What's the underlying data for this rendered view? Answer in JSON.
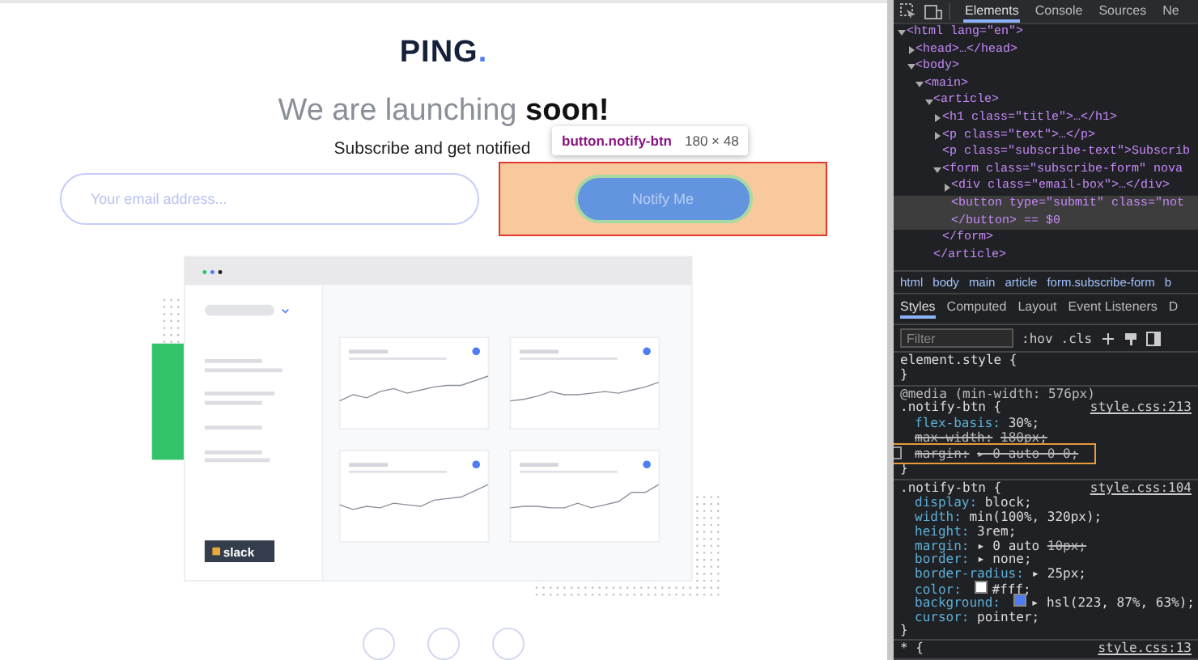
{
  "page": {
    "logo": {
      "text": "PING",
      "dot": "."
    },
    "heading": "We are launching **soon!**",
    "subtitle": "Subscribe and get notified",
    "email_field": {
      "placeholder": "Your email address..."
    },
    "notify_button": {
      "label": "Notify Me"
    },
    "inspect_tooltip": {
      "selector": "button.notify-btn",
      "size": "180 × 48"
    },
    "dashboard": {
      "slack_badge": "slack"
    }
  },
  "devtools": {
    "tabs": [
      {
        "label": "Elements",
        "selected": true
      },
      {
        "label": "Console",
        "selected": false
      },
      {
        "label": "Sources",
        "selected": false
      },
      {
        "label": "Ne",
        "selected": false
      }
    ],
    "dom_tree": [
      {
        "text": "<html lang=\"en\">",
        "expanded": true,
        "selected": false,
        "children": [
          {
            "text": "<head>…</head>",
            "expanded": false,
            "selected": false
          },
          {
            "text": "<body>",
            "expanded": true,
            "selected": false,
            "children": [
              {
                "text": "<main>",
                "expanded": true,
                "selected": false,
                "children": [
                  {
                    "text": "<article>",
                    "expanded": true,
                    "selected": false,
                    "closing": "</article>",
                    "children": [
                      {
                        "text": "<h1 class=\"title\">…</h1>",
                        "expanded": false,
                        "selected": false
                      },
                      {
                        "text": "<p class=\"text\">…</p>",
                        "expanded": false,
                        "selected": false
                      },
                      {
                        "text": "<p class=\"subscribe-text\">Subscrib",
                        "selected": false
                      },
                      {
                        "text": "<form class=\"subscribe-form\" nova",
                        "expanded": true,
                        "selected": false,
                        "closing": "</form>",
                        "children": [
                          {
                            "text": "<div class=\"email-box\">…</div>",
                            "expanded": false,
                            "selected": false
                          },
                          {
                            "text": "<button type=\"submit\" class=\"not",
                            "selected": true,
                            "closing": "</button> == $0"
                          }
                        ]
                      }
                    ]
                  }
                ]
              }
            ]
          }
        ]
      }
    ],
    "breadcrumbs": [
      "html",
      "body",
      "main",
      "article",
      "form.subscribe-form",
      "b"
    ],
    "pane_tabs": [
      {
        "label": "Styles",
        "selected": true
      },
      {
        "label": "Computed",
        "selected": false
      },
      {
        "label": "Layout",
        "selected": false
      },
      {
        "label": "Event Listeners",
        "selected": false
      },
      {
        "label": "D",
        "selected": false
      }
    ],
    "filter": {
      "placeholder": "Filter"
    },
    "filter_buttons": [
      ":hov",
      ".cls"
    ],
    "rules": [
      {
        "selector": "element.style {",
        "closing": "}"
      },
      {
        "media": "@media (min-width: 576px)",
        "selector": ".notify-btn {",
        "source": "style.css:213",
        "closing": "}",
        "declarations": [
          {
            "prop": "flex-basis:",
            "value": "30%;",
            "enabled": true,
            "struck": false
          },
          {
            "prop": "max-width:",
            "value": "180px;",
            "enabled": true,
            "struck": true
          },
          {
            "prop": "margin:",
            "value": "▸ 0 auto 0 0;",
            "enabled": false,
            "struck": true,
            "highlighted": true
          }
        ]
      },
      {
        "selector": ".notify-btn {",
        "source": "style.css:104",
        "closing": "}",
        "declarations": [
          {
            "prop": "display:",
            "value": "block;",
            "enabled": true,
            "struck": false
          },
          {
            "prop": "width:",
            "value": "min(100%, 320px);",
            "enabled": true,
            "struck": false
          },
          {
            "prop": "height:",
            "value": "3rem;",
            "enabled": true,
            "struck": false
          },
          {
            "prop": "margin:",
            "value": "▸ 0 auto",
            "overridden": "10px;",
            "enabled": true,
            "struck": false
          },
          {
            "prop": "border:",
            "value": "▸ none;",
            "enabled": true,
            "struck": false
          },
          {
            "prop": "border-radius:",
            "value": "▸ 25px;",
            "enabled": true,
            "struck": false
          },
          {
            "prop": "color:",
            "value": "#fff;",
            "color": "#ffffff",
            "enabled": true,
            "struck": false
          },
          {
            "prop": "background:",
            "value": "▸ hsl(223, 87%, 63%);",
            "color": "#4f7cf0",
            "enabled": true,
            "struck": false
          },
          {
            "prop": "cursor:",
            "value": "pointer;",
            "enabled": true,
            "struck": false
          }
        ]
      },
      {
        "selector": "* {",
        "source": "style.css:13"
      }
    ]
  }
}
